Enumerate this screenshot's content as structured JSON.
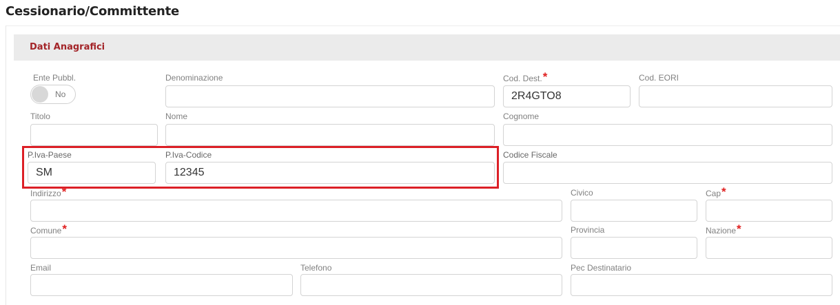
{
  "page": {
    "title": "Cessionario/Committente"
  },
  "section": {
    "title": "Dati Anagrafici"
  },
  "fields": {
    "ente_pubbl": {
      "label": "Ente Pubbl.",
      "value": "No"
    },
    "denominazione": {
      "label": "Denominazione",
      "value": ""
    },
    "cod_dest": {
      "label": "Cod. Dest.",
      "value": "2R4GTO8",
      "required": "*"
    },
    "cod_eori": {
      "label": "Cod. EORI",
      "value": ""
    },
    "titolo": {
      "label": "Titolo",
      "value": ""
    },
    "nome": {
      "label": "Nome",
      "value": ""
    },
    "cognome": {
      "label": "Cognome",
      "value": ""
    },
    "piva_paese": {
      "label": "P.Iva-Paese",
      "value": "SM"
    },
    "piva_codice": {
      "label": "P.Iva-Codice",
      "value": "12345"
    },
    "codice_fiscale": {
      "label": "Codice Fiscale",
      "value": ""
    },
    "indirizzo": {
      "label": "Indirizzo",
      "value": "",
      "required": "*"
    },
    "civico": {
      "label": "Civico",
      "value": ""
    },
    "cap": {
      "label": "Cap",
      "value": "",
      "required": "*"
    },
    "comune": {
      "label": "Comune",
      "value": "",
      "required": "*"
    },
    "provincia": {
      "label": "Provincia",
      "value": ""
    },
    "nazione": {
      "label": "Nazione",
      "value": "",
      "required": "*"
    },
    "email": {
      "label": "Email",
      "value": ""
    },
    "telefono": {
      "label": "Telefono",
      "value": ""
    },
    "pec_destinatario": {
      "label": "Pec Destinatario",
      "value": ""
    }
  },
  "colors": {
    "required": "#e02020",
    "section_title": "#a32428",
    "highlight_border": "#dc1f26"
  }
}
